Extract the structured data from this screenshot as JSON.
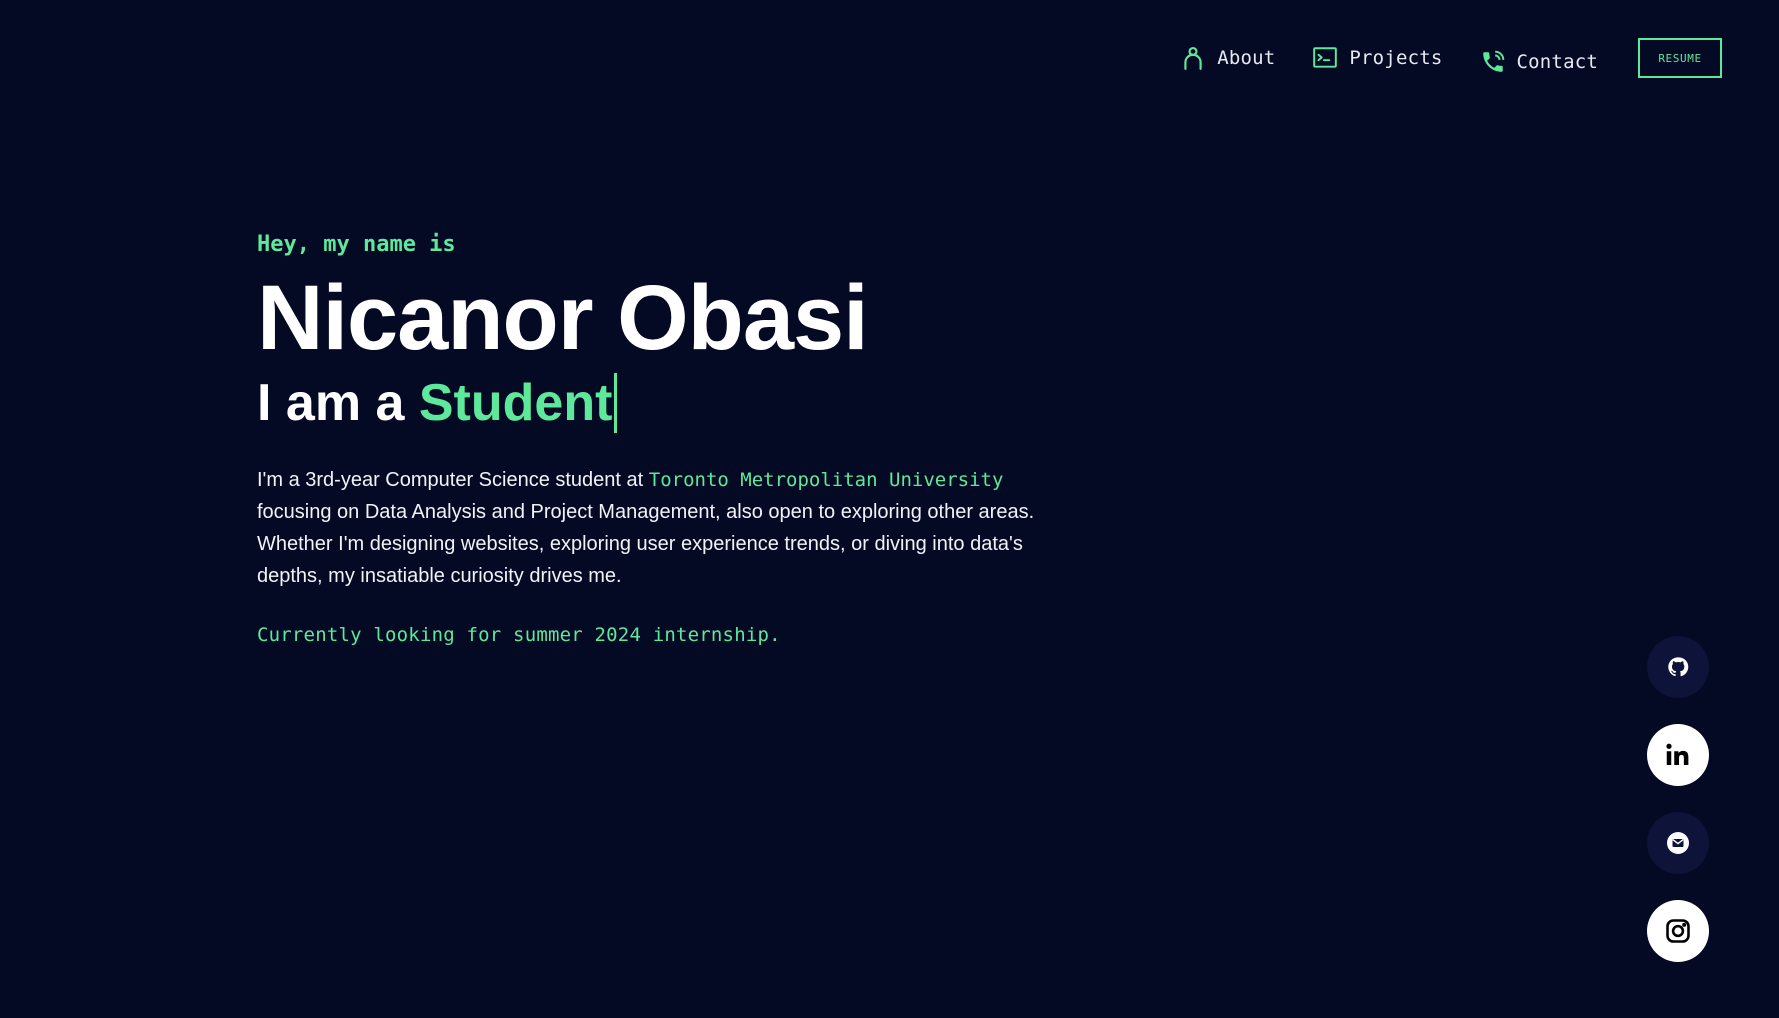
{
  "nav": {
    "items": [
      {
        "label": "About",
        "icon": "person-icon"
      },
      {
        "label": "Projects",
        "icon": "terminal-icon"
      },
      {
        "label": "Contact",
        "icon": "phone-icon"
      }
    ],
    "resume_label": "RESUME"
  },
  "hero": {
    "greeting": "Hey, my name is",
    "name": "Nicanor Obasi",
    "role_prefix": "I am a ",
    "role_word": "Student",
    "bio_before": "I'm a 3rd-year Computer Science student at ",
    "bio_university": "Toronto Metropolitan University",
    "bio_after": " focusing on Data Analysis and Project Management, also open to exploring other areas. Whether I'm designing websites, exploring user experience trends, or diving into data's depths, my insatiable curiosity drives me.",
    "status": "Currently looking for summer 2024 internship."
  },
  "social": [
    {
      "name": "github",
      "icon": "github-icon"
    },
    {
      "name": "linkedin",
      "icon": "linkedin-icon"
    },
    {
      "name": "email",
      "icon": "mail-icon"
    },
    {
      "name": "instagram",
      "icon": "instagram-icon"
    }
  ],
  "colors": {
    "background": "#050a24",
    "accent": "#5ee89b",
    "text": "#ffffff",
    "social_dark": "#0d1339"
  }
}
